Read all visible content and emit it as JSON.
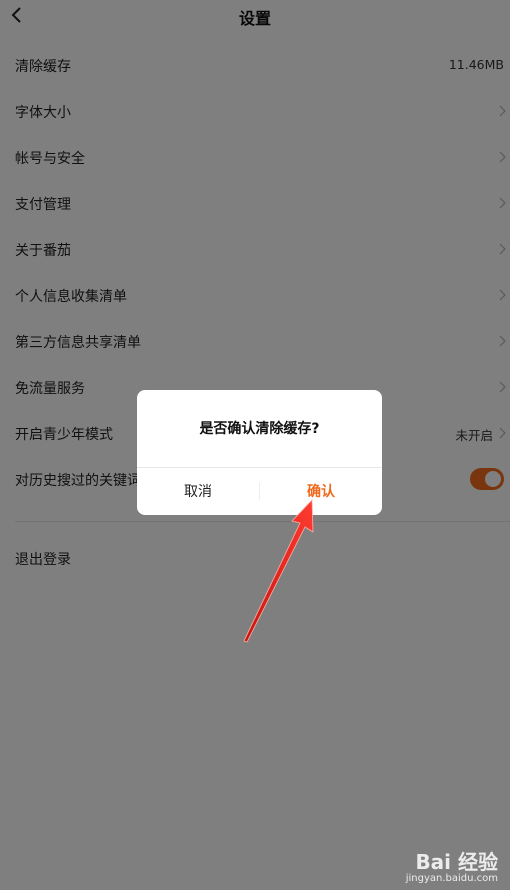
{
  "header": {
    "title": "设置",
    "back_icon": "back-arrow-icon"
  },
  "settings": [
    {
      "label": "清除缓存",
      "value": "11.46MB",
      "chevron": false
    },
    {
      "label": "字体大小",
      "value": "",
      "chevron": true
    },
    {
      "label": "帐号与安全",
      "value": "",
      "chevron": true
    },
    {
      "label": "支付管理",
      "value": "",
      "chevron": true
    },
    {
      "label": "关于番茄",
      "value": "",
      "chevron": true
    },
    {
      "label": "个人信息收集清单",
      "value": "",
      "chevron": true
    },
    {
      "label": "第三方信息共享清单",
      "value": "",
      "chevron": true
    },
    {
      "label": "免流量服务",
      "value": "",
      "chevron": true
    },
    {
      "label": "开启青少年模式",
      "value": "未开启",
      "chevron": true
    },
    {
      "label": "对历史搜过的关键词",
      "toggle": true,
      "toggle_on": true
    }
  ],
  "logout_label": "退出登录",
  "dialog": {
    "message": "是否确认清除缓存?",
    "cancel_label": "取消",
    "confirm_label": "确认"
  },
  "watermark": {
    "logo": "Bai 经验",
    "url": "jingyan.baidu.com"
  },
  "colors": {
    "accent": "#f06a1c",
    "overlay": "rgba(0,0,0,0.5)",
    "annotation_arrow": "#e8241c"
  }
}
